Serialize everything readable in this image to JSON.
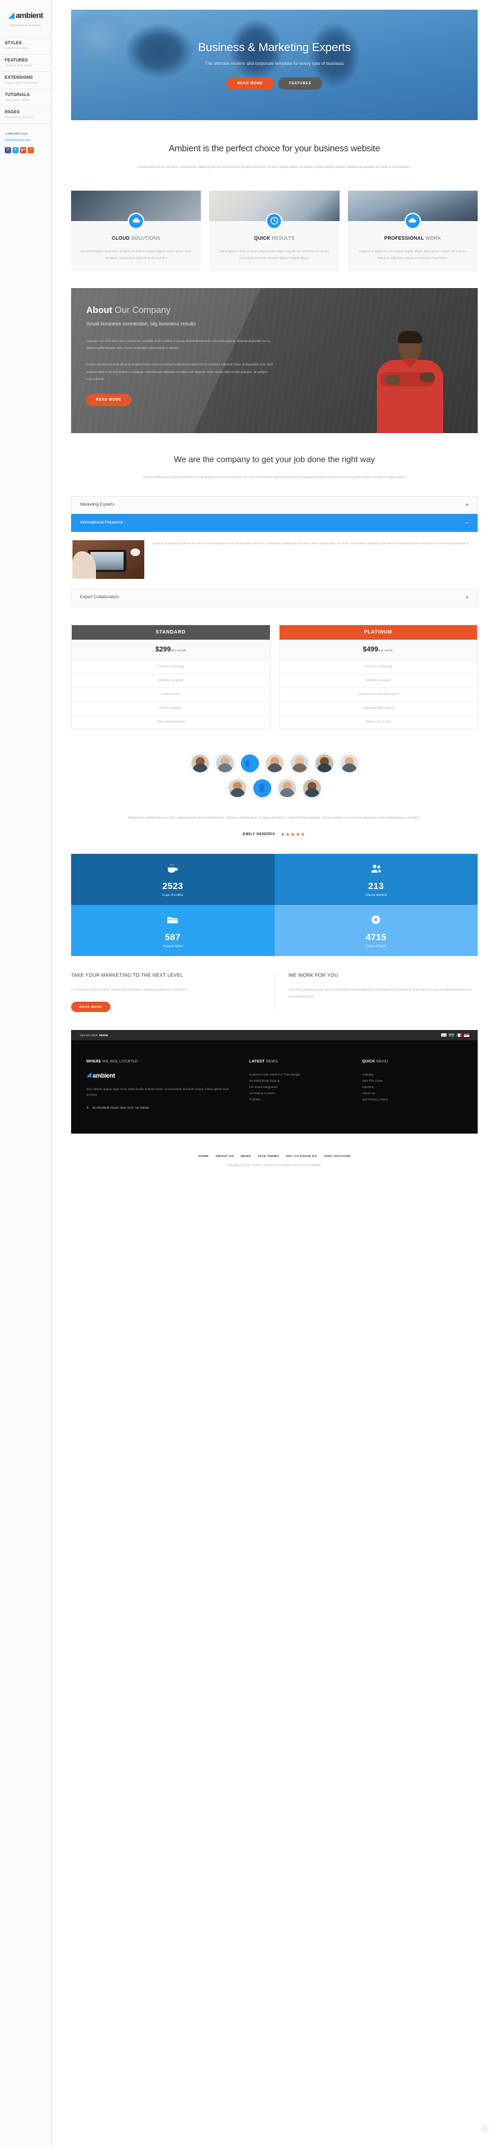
{
  "sidebar": {
    "logo": {
      "text": "ambient",
      "tagline": "MODERN BUSINESS"
    },
    "items": [
      {
        "title": "STYLES",
        "sub": "LIGHT OR DARK"
      },
      {
        "title": "FEATURES",
        "sub": "WHAT'S INCLUDED"
      },
      {
        "title": "EXTENSIONS",
        "sub": "TOOLS AND MODULES"
      },
      {
        "title": "TUTORIALS",
        "sub": "FIND HELP HERE"
      },
      {
        "title": "PAGES",
        "sub": "PREBUILT LAYOUTS"
      }
    ],
    "phone": "1-800-555-1212",
    "email": "info@domain.com",
    "socials": [
      {
        "name": "facebook",
        "glyph": "f"
      },
      {
        "name": "twitter",
        "glyph": "t"
      },
      {
        "name": "google-plus",
        "glyph": "g+"
      },
      {
        "name": "rss",
        "glyph": "◔"
      }
    ]
  },
  "hero": {
    "title": "Business & Marketing Experts",
    "subtitle": "The ultimate modern and corporate template for every type of business",
    "primary_button": "READ MORE",
    "secondary_button": "FEATURES"
  },
  "intro": {
    "heading": "Ambient is the perfect choice for your business website",
    "text": "Lorem ipsum dolor sit amet, consectetur adipicing elit sed do eiusmod tempor incid dunt ut lorem ipsum labore et dolore magna aliqua Aliquam adipiscing egestas leo Duis et erat aliquam."
  },
  "services": [
    {
      "title_bold": "CLOUD",
      "title_rest": " SOLUTIONS",
      "icon": "cloud-icon",
      "text": "Eiusmod tempor incid dunt ut labore et dolore magna aliqua Lorem ipsum dolor sit amet, consectetur adipi icing elit sed do."
    },
    {
      "title_bold": "QUICK",
      "title_rest": " RESULTS",
      "icon": "clock-icon",
      "text": "Lorem ipsum dolor sit amet, consectetur adipi icing elit sed do eiusmod tempor incid dunt ut labore et lorem dolore magna aliqua."
    },
    {
      "title_bold": "PROFESSIONAL",
      "title_rest": " WORK",
      "icon": "cloud-icon",
      "text": "Aliquam ut mollis mi. Ut congue augue. Morbi diam ipsum dictum vel erat eu. Interdum bibendum ipsum mi a lacinia risus lorem."
    }
  ],
  "about": {
    "title_bold": "About",
    "title_rest": " Our Company",
    "subtitle": "Small business connection, big business results",
    "paragraph1": "Quisque non nibh sed metus commodo convallis. Duis a tellus ut neque laoreet fermentum. Sed ante sapien, aliquam dignissim ex eu, dapibus pellentesque velit. Fusce vestibulum porta turpis eu aliquet.",
    "paragraph2": "Nullam elementum ante sit amet fringilla facilisi. Donec tincidunt vehicula tincidunt. Proin tincidunt interdum risus, id imperdiet urna. Sed pulvinar vitae enim fermentum consequat. Pellentesque pharetra eu tellus sed aliquam. Nunc mollis nibh et odio posuere, id semper eros pulvinar.",
    "button": "READ MORE"
  },
  "section2": {
    "heading": "We are the company to get your job done the right way",
    "text": "Aliquam adipiscing egestas leo Duis et erat aliquam Lorem ipsum dolor sit amet, consectetur adipiscing elit sed do eiusmod tempor incid dunt ut lorem ipsum labore et dolore magna aliqua."
  },
  "accordion": [
    {
      "label": "Marketing Experts",
      "state": "collapsed",
      "sign": "+"
    },
    {
      "label": "International Presence",
      "state": "expanded",
      "sign": "–",
      "body": "Aliquam adipiscing egestas leo Duis et erat aliquam Lorem ipsum dolor sit amet, consectetur adipiscing elit sed. Lorem ipsum dolor sit amet, consectetur adipiicing elit sed do eiusmod tempor incid dunt ut lorem ipsum labore et."
    },
    {
      "label": "Expert Collaboration",
      "state": "collapsed",
      "sign": "+"
    }
  ],
  "pricing": [
    {
      "name": "STANDARD",
      "price": "$299",
      "period": "/per month",
      "features": [
        "4 Hours Coaching",
        "Website Analysis",
        "Audit Report",
        "Phone Support",
        "Team Development"
      ]
    },
    {
      "name": "PLATINUM",
      "price": "$499",
      "period": "/per month",
      "features": [
        "20 Hours Coaching",
        "Website Analysis",
        "Complete Financial Report",
        "Individualized Support",
        "Team Flow Chart"
      ]
    }
  ],
  "testimonial": {
    "quote": "\"Maecenas sollicitudin arcu odio, vitae pharetra ipsum blandit sed. Aliquam volutpat arcu id augue hendrerit, ut lobortis felis egestas. Fusce porttitor ex non urna maximus luctus pellentesque convallis.\"",
    "author": "EMILY HENDRIX",
    "stars": "★★★★★",
    "star_color": "#e8542a"
  },
  "counters": [
    {
      "icon": "coffee-cup-icon",
      "glyph": "☕",
      "number": "2523",
      "label": "Cups of Coffee",
      "color": "#1565a0"
    },
    {
      "icon": "users-icon",
      "glyph": "👥",
      "number": "213",
      "label": "Clients Worked",
      "color": "#1e86cf"
    },
    {
      "icon": "folder-icon",
      "glyph": "📁",
      "number": "587",
      "label": "Projects Done",
      "color": "#2aa3f5"
    },
    {
      "icon": "gear-icon",
      "glyph": "⚙",
      "number": "4715",
      "label": "Hours of Work",
      "color": "#64b8f5"
    }
  ],
  "cta_columns": [
    {
      "heading": "TAKE YOUR MARKETING TO THE NEXT LEVEL",
      "text": "Lorem ipsum dolor sit amet, consectetur aled leium adipiscing elitd onec ete lorem.",
      "button": "READ MORE"
    },
    {
      "heading": "WE WORK FOR YOU",
      "text": "Aled leium adipiscing elit. Donec et eleifend Diams dignissim sit ametlobo tis vestibulum lorem ipsum turpis et malesuada fames ac ante ipsum primis.",
      "button": null
    }
  ],
  "footer": {
    "breadcrumb_prefix": "You are here:",
    "breadcrumb_current": "Home",
    "flags": [
      "#cfcfcf",
      "#8a8a8a",
      "#2a4d9e",
      "#d13b3b"
    ],
    "col_located": {
      "heading_bold": "WHERE",
      "heading_rest": " WE ARE LOCATED",
      "logo_text": "ambient",
      "text": "Sed ultrices augue eget risus. Nulla facilis Suspen disse consectetuer tincidunt neque Class aptent tacit sociosq",
      "address": "35 Elizabeth Street, New York, US 33026"
    },
    "col_news": {
      "heading_bold": "LATEST",
      "heading_rest": " NEWS",
      "links": [
        "Custom Code Used For This Design",
        "S5 MailChimp Signup",
        "Ion Icons Integrated",
        "S5 Popup Contact",
        "Portfolio"
      ]
    },
    "col_menu": {
      "heading_bold": "QUICK",
      "heading_rest": " MENU",
      "links": [
        "Training",
        "Join The Crew",
        "Careers",
        "About Us",
        "Our Privacy Policy"
      ]
    },
    "bottom_nav": [
      "HOME",
      "ABOUT US",
      "NEWS",
      "SITE TERMS",
      "GET TO KNOW US",
      "OUR LOCATION"
    ],
    "copyright": "Copyright @ 2015. Ambient. Designed by Shape5.com Joomla Templates."
  },
  "theme": {
    "accent_blue": "#2196f3",
    "accent_orange": "#e8542a",
    "dark": "#555555"
  }
}
